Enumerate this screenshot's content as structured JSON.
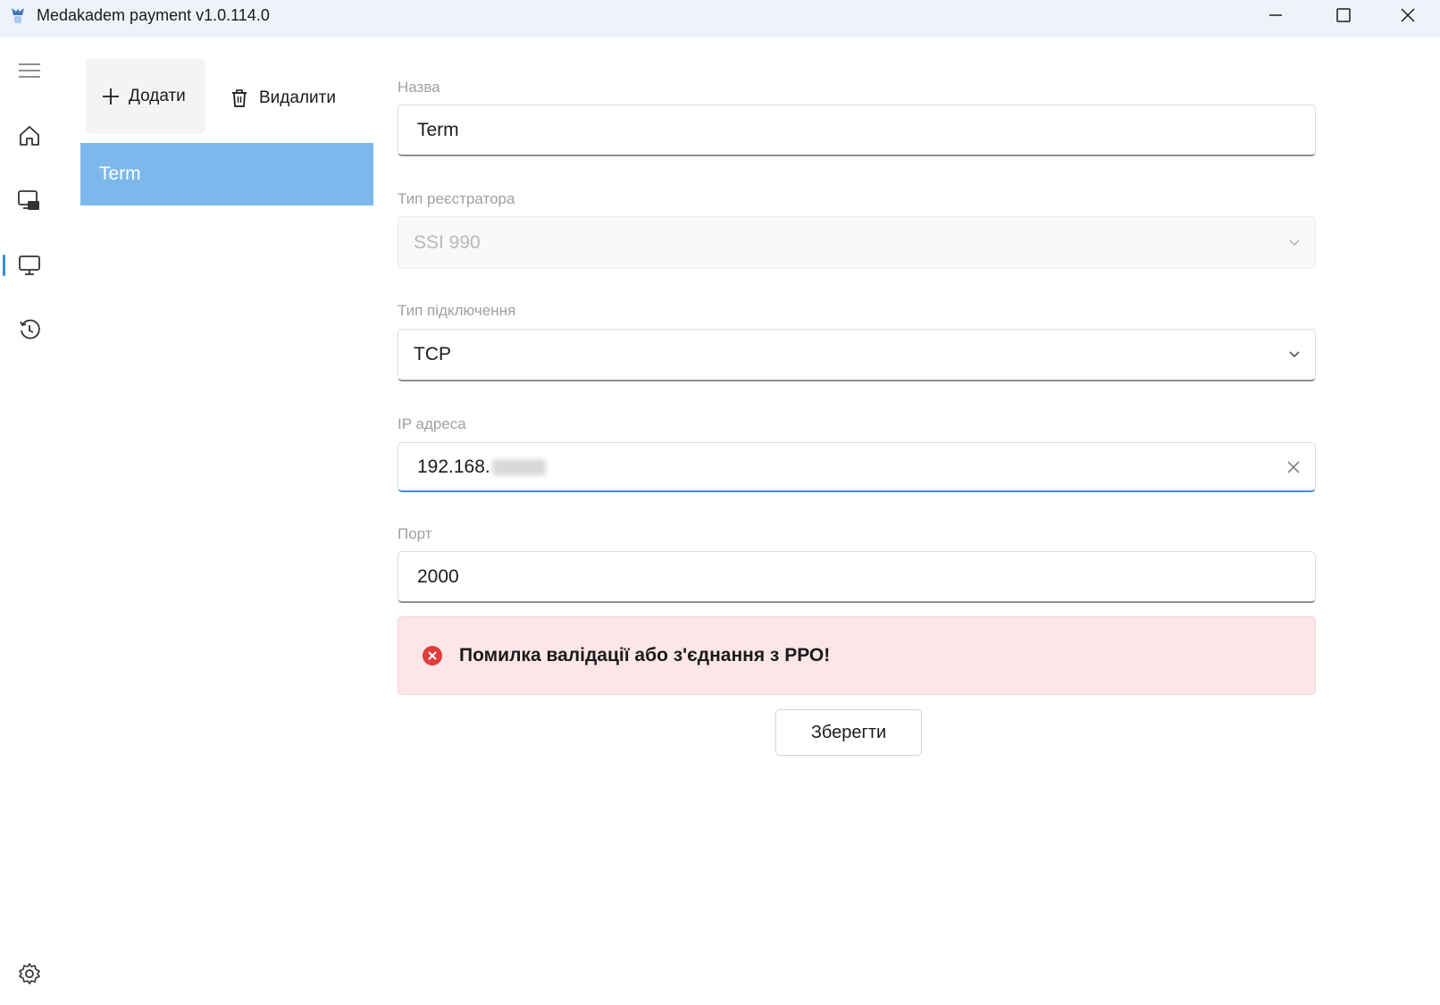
{
  "window": {
    "title": "Medakadem payment v1.0.114.0"
  },
  "nav": {
    "items": [
      "menu-icon",
      "home-icon",
      "payment-terminal-icon",
      "monitor-icon",
      "history-icon"
    ],
    "settings_icon": "gear-icon",
    "active": "monitor-icon"
  },
  "toolbar": {
    "add_label": "Додати",
    "delete_label": "Видалити"
  },
  "list": {
    "items": [
      {
        "label": "Term",
        "selected": true
      }
    ]
  },
  "form": {
    "name": {
      "label": "Назва",
      "value": "Term"
    },
    "registrar_type": {
      "label": "Тип реєстратора",
      "value": "SSI 990",
      "disabled": true
    },
    "connection_type": {
      "label": "Тип підключення",
      "value": "TCP"
    },
    "ip_address": {
      "label": "IP адреса",
      "value": "192.168."
    },
    "port": {
      "label": "Порт",
      "value": "2000"
    },
    "error_message": "Помилка валідації або з'єднання з РРО!",
    "save_label": "Зберегти"
  },
  "colors": {
    "accent": "#3c8cd6",
    "selected_item_bg": "#7db8ec",
    "error_bg": "#fde6e8",
    "error_icon": "#e23b3b",
    "titlebar_bg": "#eef3f9"
  }
}
